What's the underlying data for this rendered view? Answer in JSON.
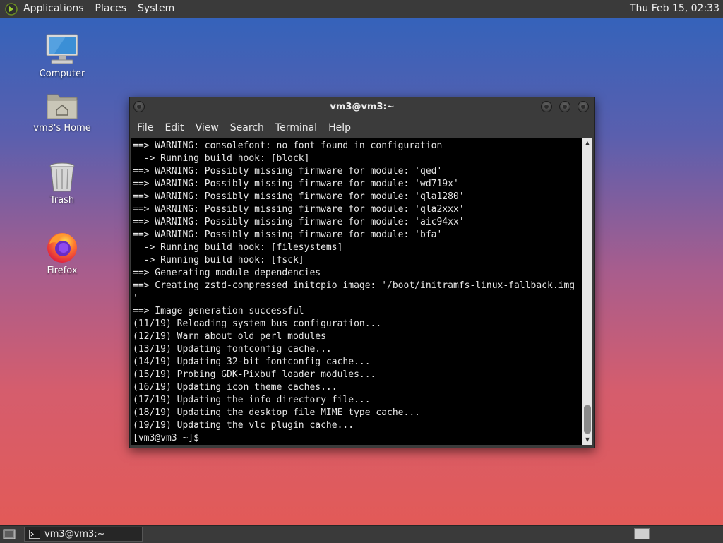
{
  "top_panel": {
    "menu": [
      "Applications",
      "Places",
      "System"
    ],
    "clock": "Thu Feb 15, 02:33"
  },
  "desktop_icons": {
    "computer": "Computer",
    "home": "vm3's Home",
    "trash": "Trash",
    "firefox": "Firefox"
  },
  "window": {
    "title": "vm3@vm3:~",
    "menu": [
      "File",
      "Edit",
      "View",
      "Search",
      "Terminal",
      "Help"
    ],
    "terminal_text": "==> WARNING: consolefont: no font found in configuration\n  -> Running build hook: [block]\n==> WARNING: Possibly missing firmware for module: 'qed'\n==> WARNING: Possibly missing firmware for module: 'wd719x'\n==> WARNING: Possibly missing firmware for module: 'qla1280'\n==> WARNING: Possibly missing firmware for module: 'qla2xxx'\n==> WARNING: Possibly missing firmware for module: 'aic94xx'\n==> WARNING: Possibly missing firmware for module: 'bfa'\n  -> Running build hook: [filesystems]\n  -> Running build hook: [fsck]\n==> Generating module dependencies\n==> Creating zstd-compressed initcpio image: '/boot/initramfs-linux-fallback.img\n'\n==> Image generation successful\n(11/19) Reloading system bus configuration...\n(12/19) Warn about old perl modules\n(13/19) Updating fontconfig cache...\n(14/19) Updating 32-bit fontconfig cache...\n(15/19) Probing GDK-Pixbuf loader modules...\n(16/19) Updating icon theme caches...\n(17/19) Updating the info directory file...\n(18/19) Updating the desktop file MIME type cache...\n(19/19) Updating the vlc plugin cache...\n[vm3@vm3 ~]$ "
  },
  "taskbar": {
    "task_label": "vm3@vm3:~"
  },
  "colors": {
    "panel": "#3a3a3a",
    "terminal_bg": "#000000",
    "terminal_fg": "#e6e6e6"
  }
}
